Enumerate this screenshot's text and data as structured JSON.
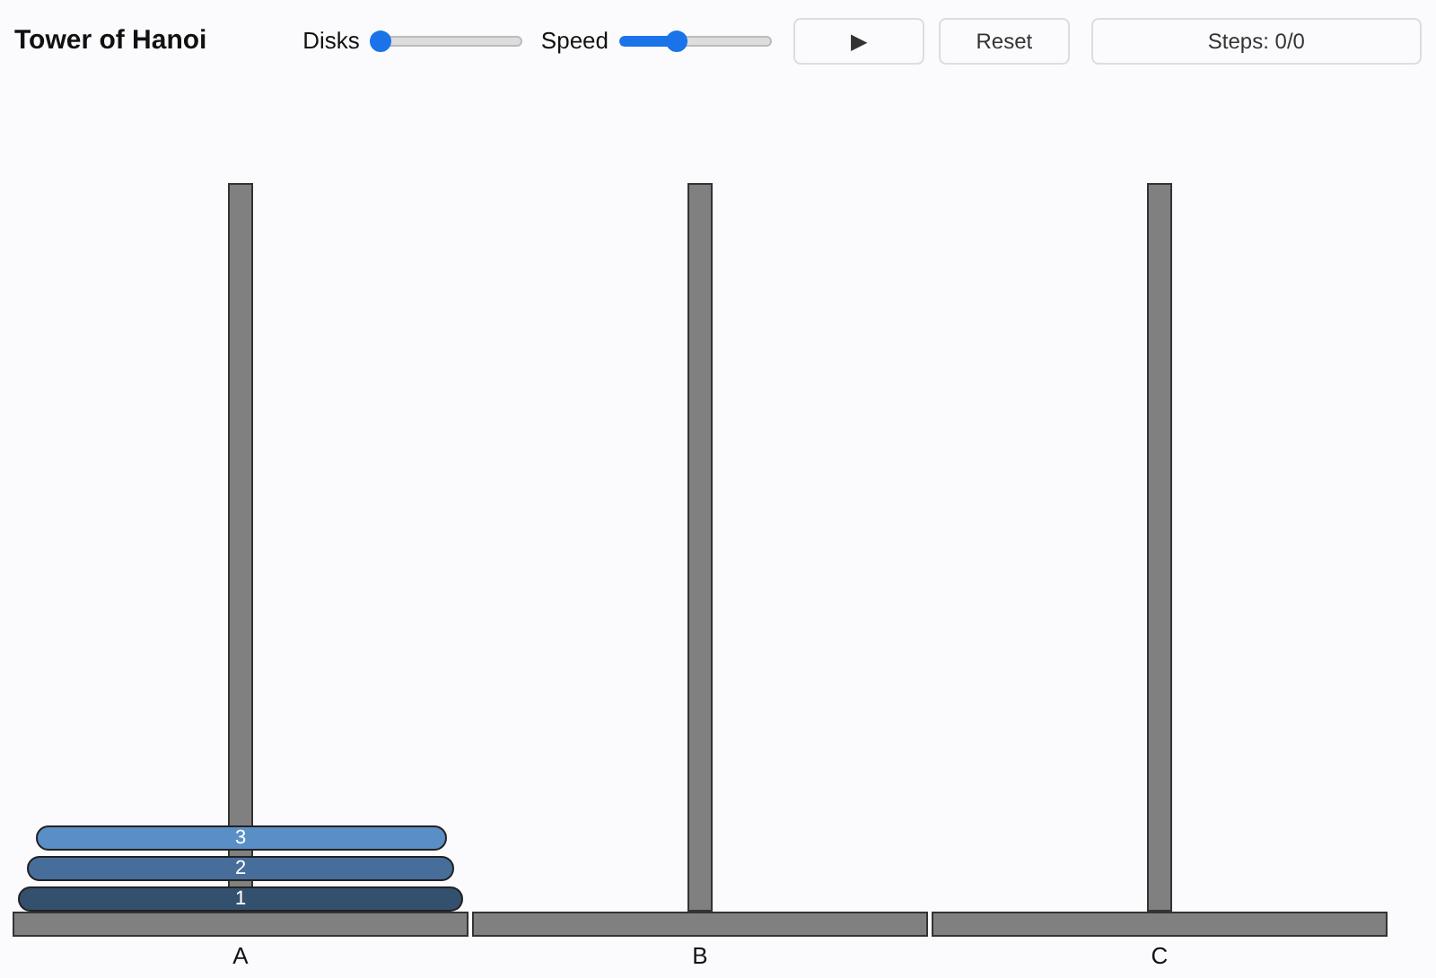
{
  "title": "Tower of Hanoi",
  "controls": {
    "disks": {
      "label": "Disks",
      "level": 0
    },
    "speed": {
      "label": "Speed",
      "level": 0.36
    },
    "play_button": "▶",
    "reset_button": "Reset",
    "steps": "Steps: 0/0"
  },
  "pegs": [
    {
      "label": "A",
      "disks": [
        {
          "label": "3",
          "color": "#5a8ec6"
        },
        {
          "label": "2",
          "color": "#476e9a"
        },
        {
          "label": "1",
          "color": "#34506f"
        }
      ]
    },
    {
      "label": "B"
    },
    {
      "label": "C"
    }
  ]
}
